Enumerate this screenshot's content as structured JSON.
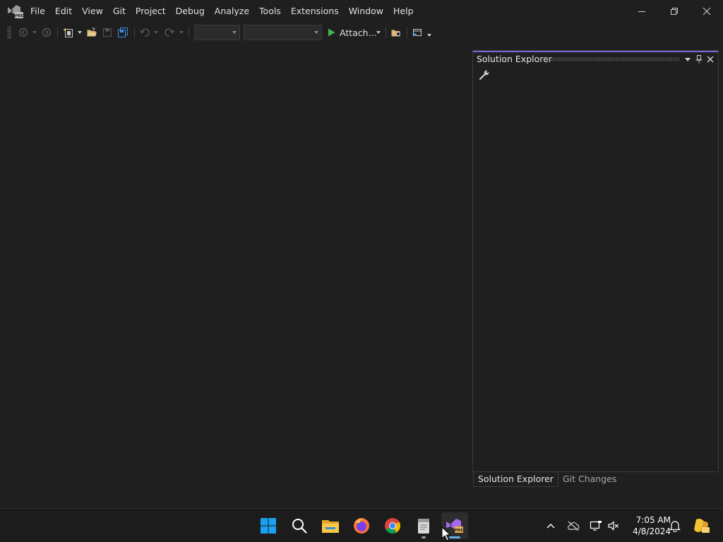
{
  "menu": {
    "items": [
      "File",
      "Edit",
      "View",
      "Git",
      "Project",
      "Debug",
      "Analyze",
      "Tools",
      "Extensions",
      "Window",
      "Help"
    ]
  },
  "app_icon": {
    "name": "visual-studio-preview-icon",
    "badge": "PRE"
  },
  "window_controls": {
    "minimize": "minimize-icon",
    "restore": "restore-icon",
    "close": "close-icon"
  },
  "toolbar": {
    "attach_label": "Attach...",
    "config_combo_value": "",
    "platform_combo_value": ""
  },
  "solution_explorer": {
    "title": "Solution Explorer"
  },
  "panel_tabs": [
    "Solution Explorer",
    "Git Changes"
  ],
  "taskbar": {
    "apps": [
      "start-icon",
      "search-icon",
      "file-explorer-icon",
      "firefox-icon",
      "chrome-icon",
      "notepad-icon",
      "visual-studio-icon"
    ],
    "time": "7:05 AM",
    "date": "4/8/2024"
  },
  "colors": {
    "accent": "#6f68d6",
    "background": "#1f1f1f",
    "start_blue": "#1aa0f0"
  }
}
